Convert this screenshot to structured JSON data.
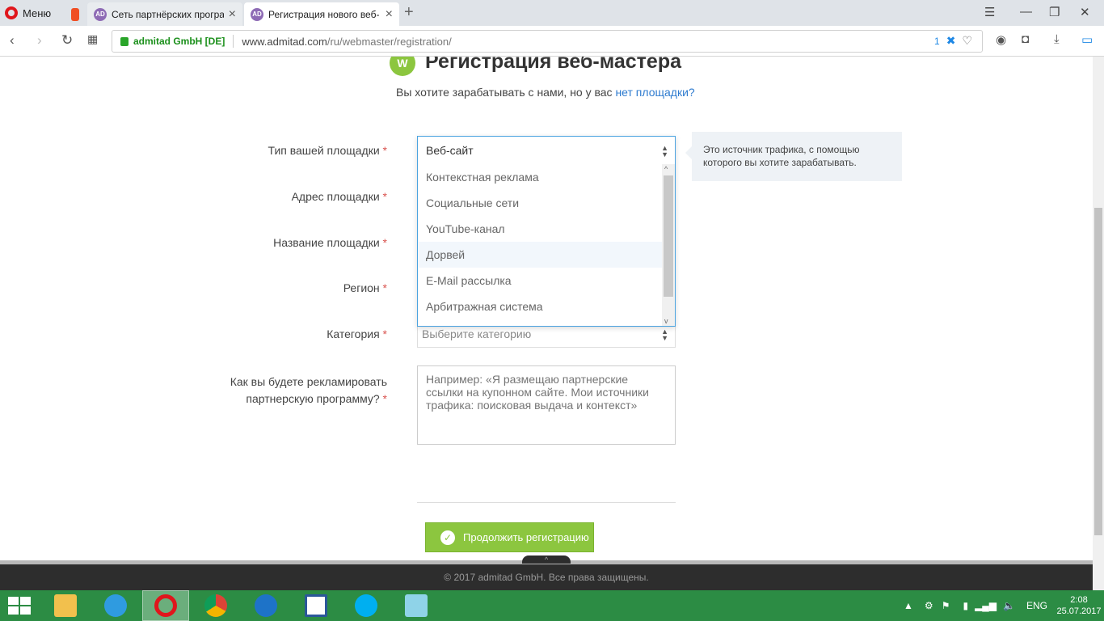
{
  "browser": {
    "menu_label": "Меню",
    "tabs": [
      {
        "title": "Сеть партнёрских програ"
      },
      {
        "title": "Регистрация нового веб-"
      }
    ],
    "site_label": "admitad GmbH [DE]",
    "url_host": "www.admitad.com",
    "url_path": "/ru/webmaster/registration/",
    "badge_count": "1"
  },
  "page": {
    "title": "Регистрация веб-мастера",
    "subtitle": "Вы хотите зарабатывать с нами, но у вас",
    "subtitle_link": "нет площадки?",
    "labels": {
      "type": "Тип вашей площадки",
      "address": "Адрес площадки",
      "name": "Название площадки",
      "region": "Регион",
      "category": "Категория",
      "advertise_line1": "Как вы будете рекламировать",
      "advertise_line2": "партнерскую программу?"
    },
    "required_mark": "*",
    "type_select": {
      "selected": "Веб-сайт",
      "options": [
        "Контекстная реклама",
        "Социальные сети",
        "YouTube-канал",
        "Дорвей",
        "E-Mail рассылка",
        "Арбитражная система"
      ],
      "highlighted_index": 3
    },
    "category_placeholder": "Выберите категорию",
    "hint": "Это источник трафика, с помощью которого вы хотите зарабатывать.",
    "textarea_placeholder": "Например: «Я размещаю партнерские ссылки на купонном сайте. Мои источники трафика: поисковая выдача и контекст»",
    "continue_button": "Продолжить регистрацию",
    "footer": "© 2017 admitad GmbH. Все права защищены."
  },
  "taskbar": {
    "lang": "ENG",
    "time": "2:08",
    "date": "25.07.2017"
  },
  "colors": {
    "accent_green": "#8cc63f",
    "link_blue": "#2e7bcf",
    "taskbar_green": "#2c8c44"
  }
}
